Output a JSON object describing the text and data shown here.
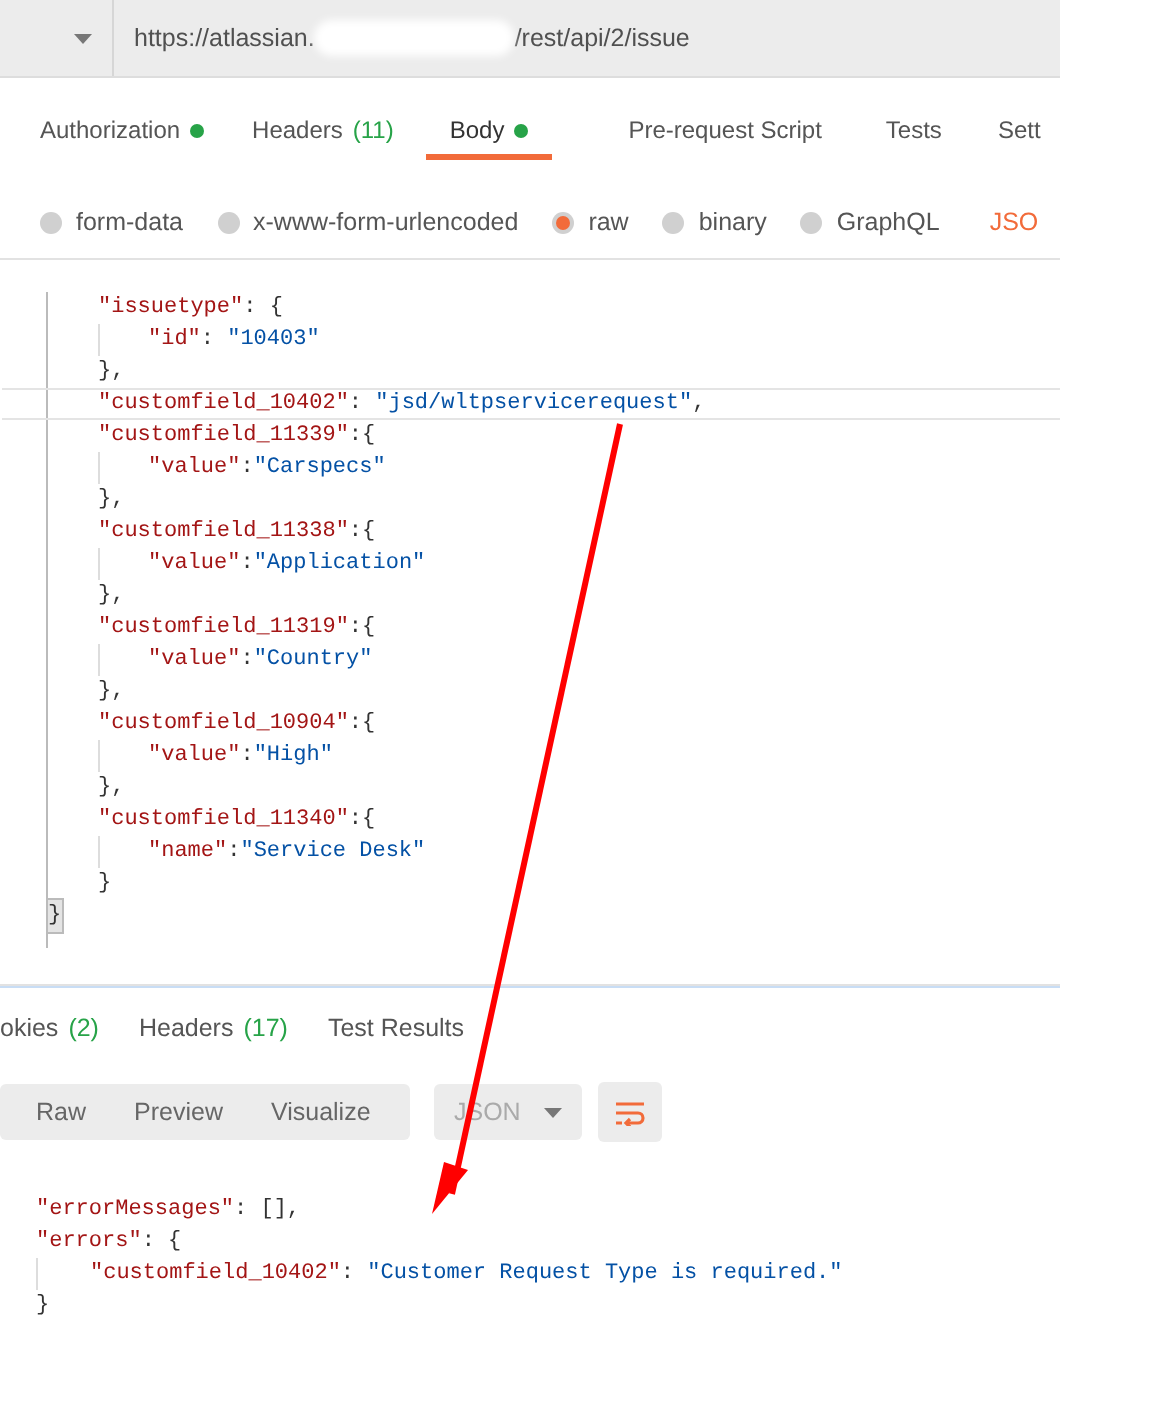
{
  "url_bar": {
    "url_start": "https://atlassian.",
    "redacted": true,
    "url_end": "/rest/api/2/issue"
  },
  "request_tabs": [
    {
      "label": "Authorization",
      "dot": true,
      "selected": false
    },
    {
      "label": "Headers",
      "count": "(11)",
      "dot": false,
      "selected": false
    },
    {
      "label": "Body",
      "dot": true,
      "selected": true
    },
    {
      "label": "Pre-request Script",
      "dot": false,
      "selected": false
    },
    {
      "label": "Tests",
      "dot": false,
      "selected": false
    },
    {
      "label": "Sett",
      "dot": false,
      "selected": false
    }
  ],
  "body_types": [
    {
      "kind": "radio",
      "label": "form-data",
      "selected": false
    },
    {
      "kind": "radio",
      "label": "x-www-form-urlencoded",
      "selected": false
    },
    {
      "kind": "radio",
      "label": "raw",
      "selected": true
    },
    {
      "kind": "radio",
      "label": "binary",
      "selected": false
    },
    {
      "kind": "radio",
      "label": "GraphQL",
      "selected": false
    },
    {
      "kind": "format",
      "label": "JSO",
      "selected": false
    }
  ],
  "request_body": {
    "lines": [
      {
        "tokens": [
          {
            "kind": "key",
            "text": "\"issuetype\""
          },
          {
            "kind": "punct",
            "text": ": {"
          }
        ],
        "children": [
          {
            "tokens": [
              {
                "kind": "key",
                "text": "\"id\""
              },
              {
                "kind": "punct",
                "text": ": "
              },
              {
                "kind": "string",
                "text": "\"10403\""
              }
            ]
          }
        ]
      },
      {
        "tokens": [
          {
            "kind": "punct",
            "text": "},"
          }
        ]
      },
      {
        "highlighted": true,
        "tokens": [
          {
            "kind": "key",
            "text": "\"customfield_10402\""
          },
          {
            "kind": "punct",
            "text": ": "
          },
          {
            "kind": "string",
            "text": "\"jsd/wltpservicerequest\""
          },
          {
            "kind": "punct",
            "text": ","
          }
        ]
      },
      {
        "tokens": [
          {
            "kind": "key",
            "text": "\"customfield_11339\""
          },
          {
            "kind": "punct",
            "text": ":{"
          }
        ],
        "children": [
          {
            "tokens": [
              {
                "kind": "key",
                "text": "\"value\""
              },
              {
                "kind": "punct",
                "text": ":"
              },
              {
                "kind": "string",
                "text": "\"Carspecs\""
              }
            ]
          }
        ]
      },
      {
        "tokens": [
          {
            "kind": "punct",
            "text": "},"
          }
        ]
      },
      {
        "tokens": [
          {
            "kind": "key",
            "text": "\"customfield_11338\""
          },
          {
            "kind": "punct",
            "text": ":{"
          }
        ],
        "children": [
          {
            "tokens": [
              {
                "kind": "key",
                "text": "\"value\""
              },
              {
                "kind": "punct",
                "text": ":"
              },
              {
                "kind": "string",
                "text": "\"Application\""
              }
            ]
          }
        ]
      },
      {
        "tokens": [
          {
            "kind": "punct",
            "text": "},"
          }
        ]
      },
      {
        "tokens": [
          {
            "kind": "key",
            "text": "\"customfield_11319\""
          },
          {
            "kind": "punct",
            "text": ":{"
          }
        ],
        "children": [
          {
            "tokens": [
              {
                "kind": "key",
                "text": "\"value\""
              },
              {
                "kind": "punct",
                "text": ":"
              },
              {
                "kind": "string",
                "text": "\"Country\""
              }
            ]
          }
        ]
      },
      {
        "tokens": [
          {
            "kind": "punct",
            "text": "},"
          }
        ]
      },
      {
        "tokens": [
          {
            "kind": "key",
            "text": "\"customfield_10904\""
          },
          {
            "kind": "punct",
            "text": ":{"
          }
        ],
        "children": [
          {
            "tokens": [
              {
                "kind": "key",
                "text": "\"value\""
              },
              {
                "kind": "punct",
                "text": ":"
              },
              {
                "kind": "string",
                "text": "\"High\""
              }
            ]
          }
        ]
      },
      {
        "tokens": [
          {
            "kind": "punct",
            "text": "},"
          }
        ]
      },
      {
        "tokens": [
          {
            "kind": "key",
            "text": "\"customfield_11340\""
          },
          {
            "kind": "punct",
            "text": ":{"
          }
        ],
        "children": [
          {
            "tokens": [
              {
                "kind": "key",
                "text": "\"name\""
              },
              {
                "kind": "punct",
                "text": ":"
              },
              {
                "kind": "string",
                "text": "\"Service Desk\""
              }
            ]
          }
        ]
      },
      {
        "tokens": [
          {
            "kind": "punct",
            "text": "}"
          }
        ]
      }
    ],
    "closing": {
      "text": "}",
      "matched": true
    }
  },
  "response_tabs": [
    {
      "label": "okies",
      "count": "(2)",
      "selected": false
    },
    {
      "label": "Headers",
      "count": "(17)",
      "selected": false
    },
    {
      "label": "Test Results",
      "selected": false
    }
  ],
  "view_modes": [
    {
      "label": "Raw",
      "selected": false
    },
    {
      "label": "Preview",
      "selected": false
    },
    {
      "label": "Visualize",
      "selected": false
    }
  ],
  "format_dropdown": {
    "value": "JSON"
  },
  "response_body": [
    {
      "tokens": [
        {
          "kind": "key",
          "text": "\"errorMessages\""
        },
        {
          "kind": "punct",
          "text": ": [],"
        }
      ]
    },
    {
      "tokens": [
        {
          "kind": "key",
          "text": "\"errors\""
        },
        {
          "kind": "punct",
          "text": ": {"
        }
      ],
      "children": [
        {
          "tokens": [
            {
              "kind": "key",
              "text": "\"customfield_10402\""
            },
            {
              "kind": "punct",
              "text": ": "
            },
            {
              "kind": "string",
              "text": "\"Customer Request Type is required.\""
            }
          ]
        }
      ]
    },
    {
      "tokens": [
        {
          "kind": "punct",
          "text": "}"
        }
      ]
    }
  ]
}
